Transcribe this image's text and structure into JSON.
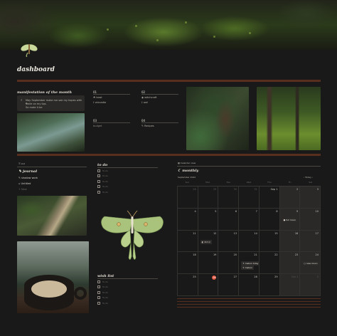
{
  "page": {
    "title": "dashboard",
    "icon": "luna-moth-icon"
  },
  "manifestation": {
    "heading": "manifestation of the month",
    "quote_line1": "May September make me see my hopes with a",
    "quote_line2": "smile on my lips.",
    "quote_line3": "So mote it be"
  },
  "columns": [
    {
      "num": "01",
      "items": [
        {
          "icon": "☘",
          "label": "tarot"
        },
        {
          "icon": "†",
          "label": "wiccadia"
        }
      ]
    },
    {
      "num": "02",
      "items": [
        {
          "icon": "◉",
          "label": "witchcraft"
        },
        {
          "icon": "†",
          "label": "owl"
        }
      ]
    },
    {
      "num": "03",
      "items": [
        {
          "icon": "",
          "label": "budget"
        }
      ]
    },
    {
      "num": "04",
      "items": [
        {
          "icon": "✎",
          "label": "Recipes"
        }
      ]
    }
  ],
  "list_view": {
    "label": "List"
  },
  "journal": {
    "heading": "journal",
    "entries": [
      "shadow work",
      "Untitled"
    ],
    "new_label": "New"
  },
  "todo": {
    "heading": "to do",
    "items": [
      "To-do",
      "To-do",
      "To-do",
      "To-do",
      "To-do"
    ]
  },
  "wishlist": {
    "heading": "wish list",
    "items": [
      "To-do",
      "To-do",
      "To-do",
      "To-do",
      "To-do"
    ]
  },
  "calendar": {
    "view_label": "Calendar view",
    "heading": "monthly",
    "month": "September 2022",
    "today_label": "Today",
    "weekdays": [
      "Sun",
      "Mon",
      "Tue",
      "Wed",
      "Thu",
      "Fri",
      "Sat"
    ],
    "weeks": [
      [
        "28",
        "29",
        "30",
        "31",
        "Sep 1",
        "2",
        "3"
      ],
      [
        "4",
        "5",
        "6",
        "7",
        "8",
        "9",
        "10"
      ],
      [
        "11",
        "12",
        "13",
        "14",
        "15",
        "16",
        "17"
      ],
      [
        "18",
        "19",
        "20",
        "21",
        "22",
        "23",
        "24"
      ],
      [
        "25",
        "26",
        "27",
        "28",
        "29",
        "Oct 1",
        "2"
      ]
    ],
    "today_cell": "26",
    "events": {
      "full_moon": "full moon",
      "third_qtr": "3rd Q",
      "new_moon": "new moon",
      "mabon": "mabon",
      "mabon_bday": "mabon bday"
    }
  },
  "colors": {
    "accent_divider": "#5a2e1f",
    "today": "#e0543f",
    "background": "#191919"
  }
}
